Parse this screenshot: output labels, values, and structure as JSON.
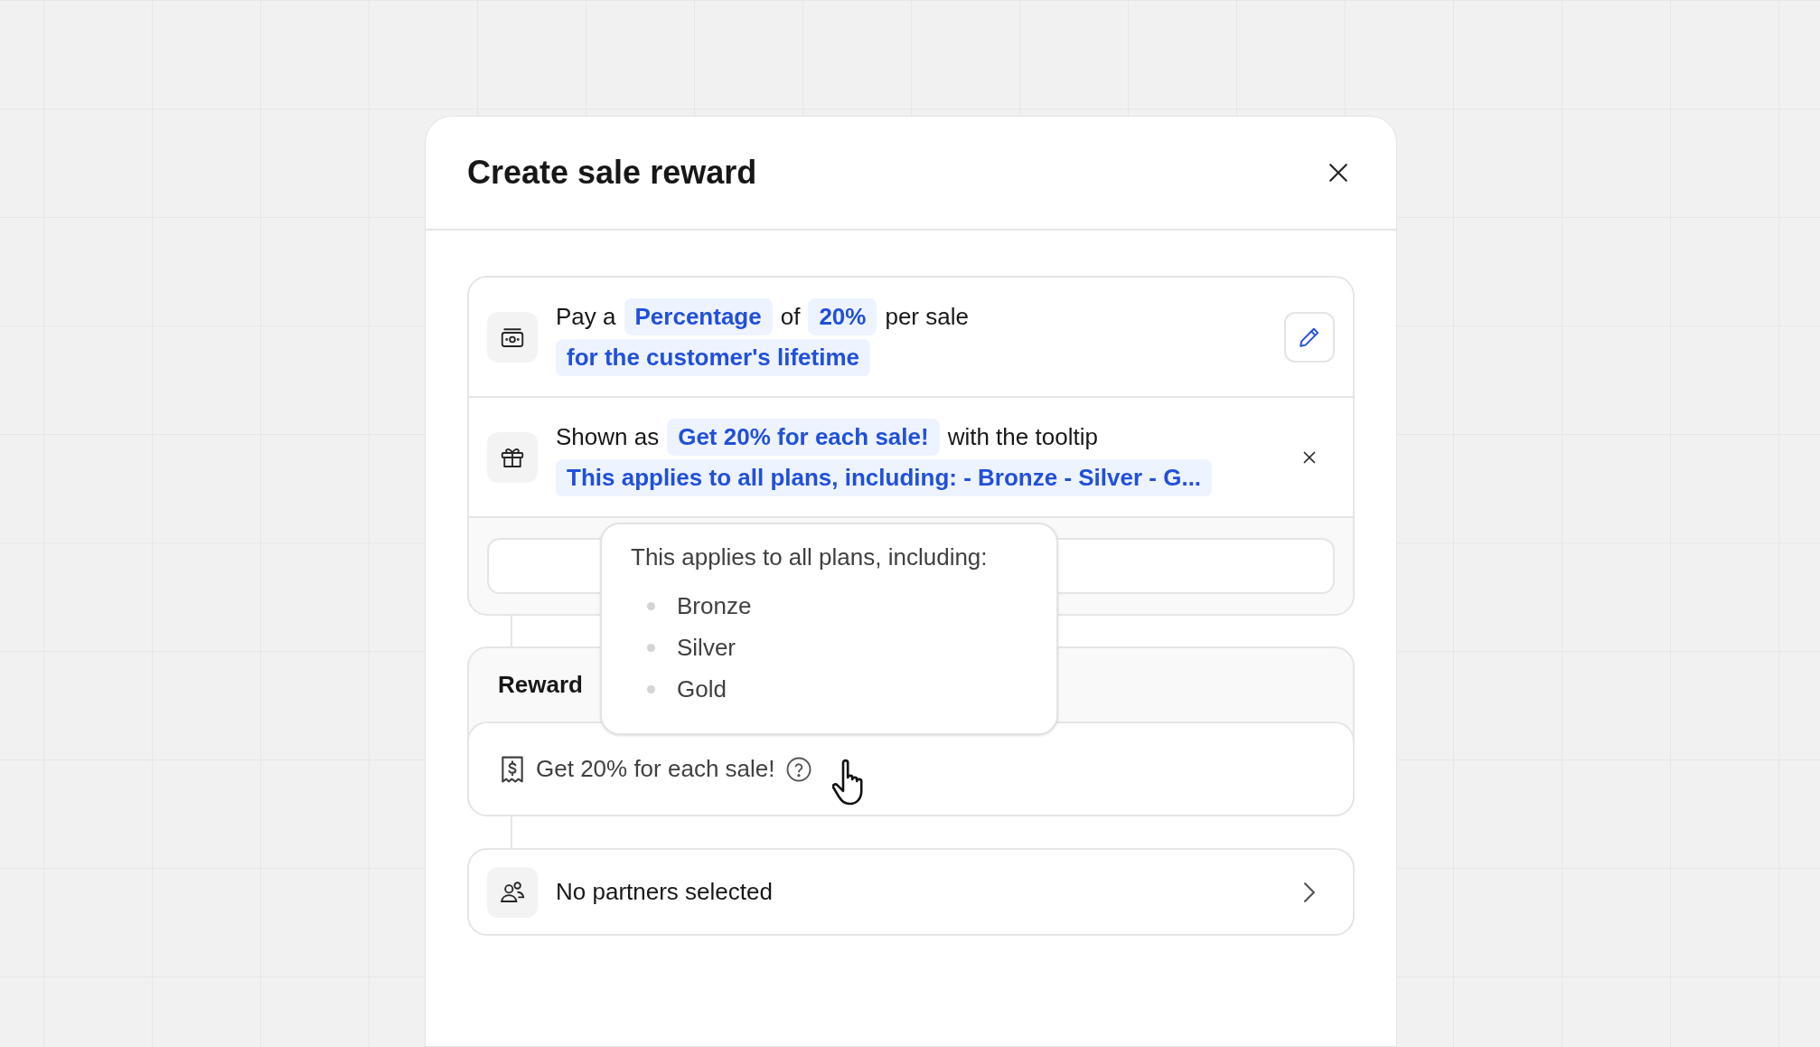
{
  "dialog": {
    "title": "Create sale reward"
  },
  "reward_rows": [
    {
      "kind": "payout",
      "lines": [
        [
          {
            "text": "Pay a",
            "highlight": false
          },
          {
            "text": "Percentage",
            "highlight": true
          },
          {
            "text": "of",
            "highlight": false
          },
          {
            "text": "20%",
            "highlight": true
          },
          {
            "text": "per sale",
            "highlight": false
          }
        ],
        [
          {
            "text": "for the customer's lifetime",
            "highlight": true
          }
        ]
      ]
    },
    {
      "kind": "display",
      "lines": [
        [
          {
            "text": "Shown as",
            "highlight": false
          },
          {
            "text": "Get 20% for each sale!",
            "highlight": true
          },
          {
            "text": "with the tooltip",
            "highlight": false
          }
        ],
        [
          {
            "text": "This applies to all plans, including: - Bronze - Silver - G...",
            "highlight": true
          }
        ]
      ]
    }
  ],
  "reward_preview": {
    "heading": "Reward",
    "label": "Get 20% for each sale!"
  },
  "tooltip": {
    "title": "This applies to all plans, including:",
    "items": [
      "Bronze",
      "Silver",
      "Gold"
    ]
  },
  "partners": {
    "label": "No partners selected"
  }
}
